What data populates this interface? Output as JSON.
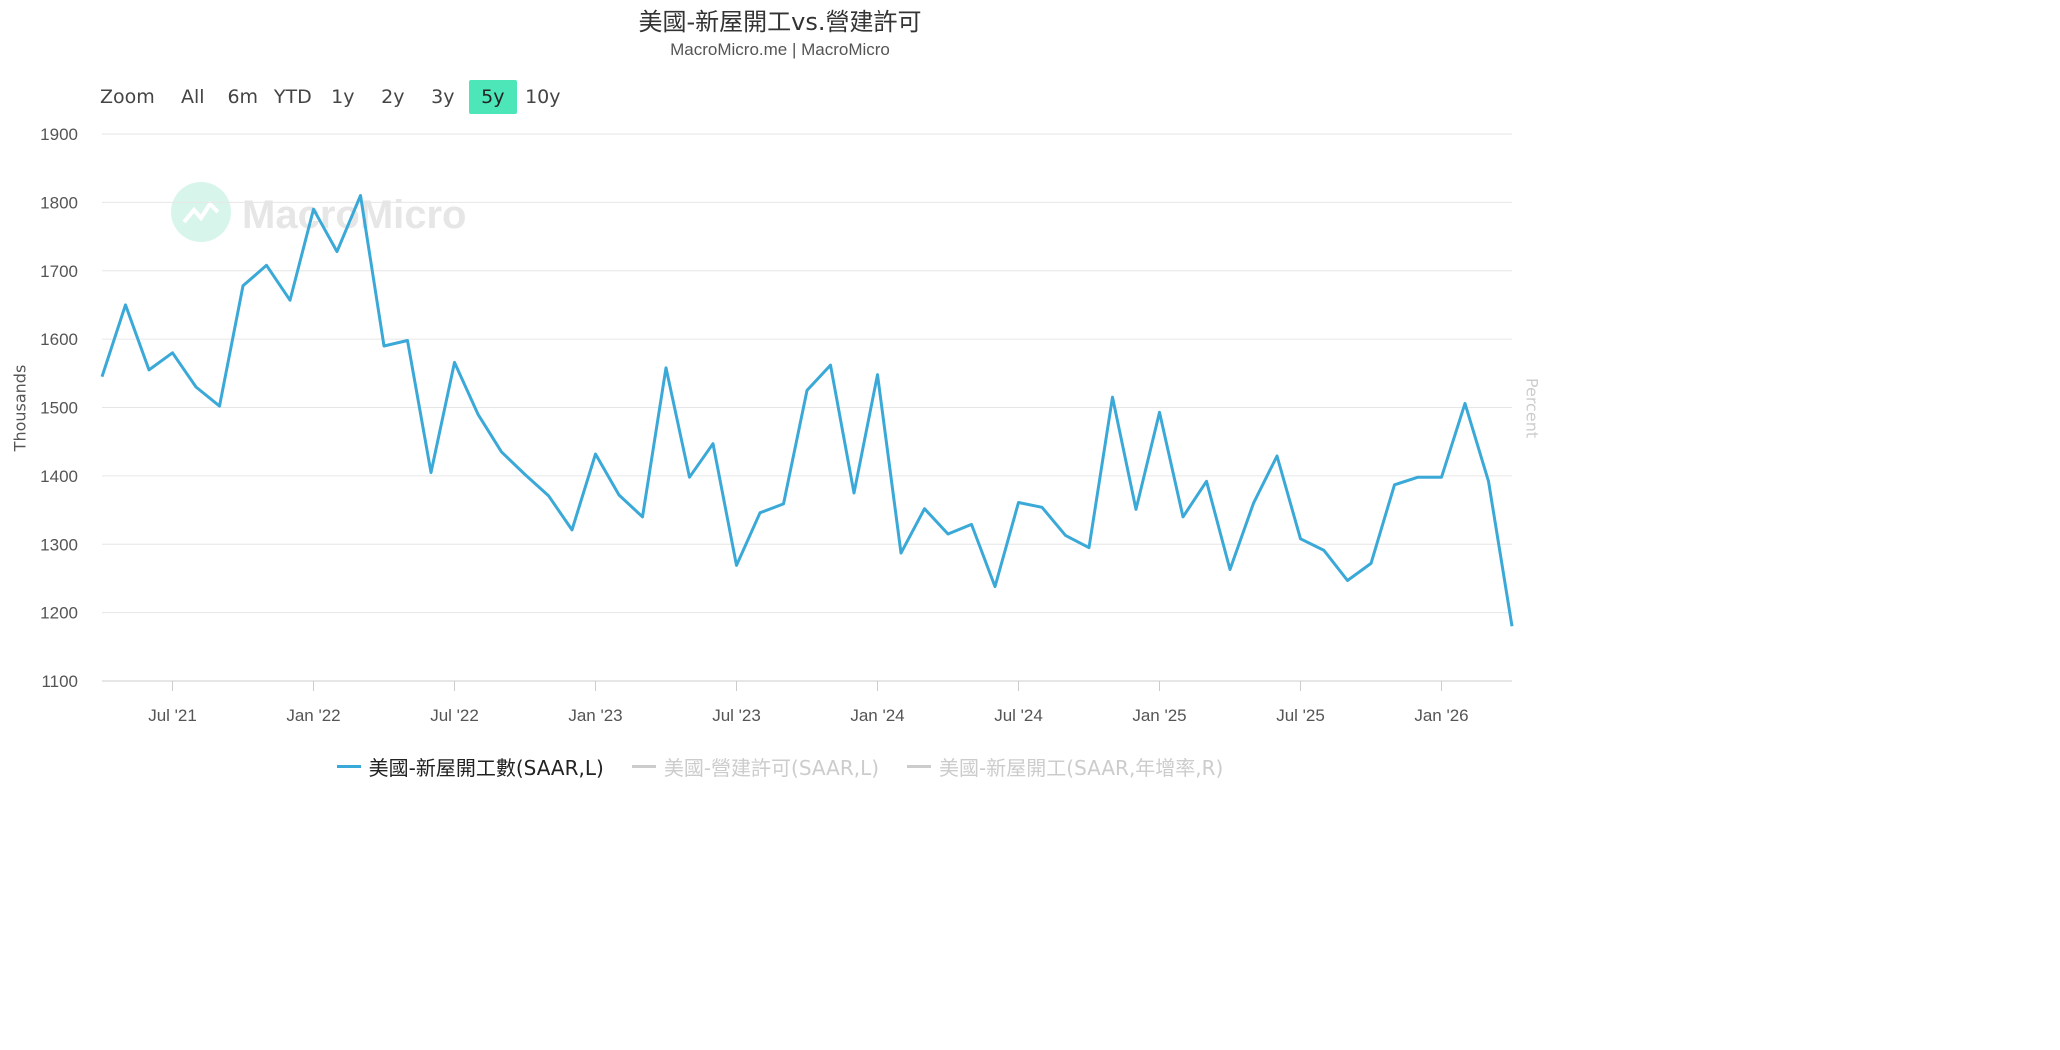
{
  "chart_data": {
    "type": "line",
    "title": "美國-新屋開工vs.營建許可",
    "subtitle": "MacroMicro.me | MacroMicro",
    "watermark": "MacroMicro",
    "ylabel": "Thousands",
    "ylabel_right": "Percent",
    "ylim": [
      1100,
      1900
    ],
    "yticks": [
      1100,
      1200,
      1300,
      1400,
      1500,
      1600,
      1700,
      1800,
      1900
    ],
    "grid": true,
    "legend_position": "bottom",
    "x_tick_labels": [
      "Jul '21",
      "Jan '22",
      "Jul '22",
      "Jan '23",
      "Jul '23",
      "Jan '24",
      "Jul '24",
      "Jan '25",
      "Jul '25",
      "Jan '26"
    ],
    "x": [
      "2021-04",
      "2021-05",
      "2021-06",
      "2021-07",
      "2021-08",
      "2021-09",
      "2021-10",
      "2021-11",
      "2021-12",
      "2022-01",
      "2022-02",
      "2022-03",
      "2022-04",
      "2022-05",
      "2022-06",
      "2022-07",
      "2022-08",
      "2022-09",
      "2022-10",
      "2022-11",
      "2022-12",
      "2023-01",
      "2023-02",
      "2023-03",
      "2023-04",
      "2023-05",
      "2023-06",
      "2023-07",
      "2023-08",
      "2023-09",
      "2023-10",
      "2023-11",
      "2023-12",
      "2024-01",
      "2024-02",
      "2024-03",
      "2024-04",
      "2024-05",
      "2024-06",
      "2024-07",
      "2024-08",
      "2024-09",
      "2024-10",
      "2024-11",
      "2024-12",
      "2025-01",
      "2025-02",
      "2025-03",
      "2025-04",
      "2025-05",
      "2025-06",
      "2025-07",
      "2025-08",
      "2025-09",
      "2025-10",
      "2025-11",
      "2025-12",
      "2026-01",
      "2026-02",
      "2026-03",
      "2026-04"
    ],
    "series": [
      {
        "name": "美國-新屋開工數(SAAR,L)",
        "color": "#3ba9d8",
        "visible": true,
        "values": [
          1545,
          1650,
          1555,
          1580,
          1530,
          1502,
          1678,
          1708,
          1657,
          1790,
          1728,
          1810,
          1590,
          1598,
          1405,
          1566,
          1490,
          1435,
          1402,
          1371,
          1321,
          1432,
          1372,
          1340,
          1558,
          1398,
          1447,
          1269,
          1346,
          1359,
          1525,
          1562,
          1375,
          1548,
          1287,
          1352,
          1315,
          1329,
          1238,
          1361,
          1354,
          1313,
          1295,
          1515,
          1351,
          1493,
          1340,
          1392,
          1263,
          1360,
          1429,
          1308,
          1291,
          1247,
          1272,
          1387,
          1398,
          1398,
          1506,
          1392,
          1180
        ]
      },
      {
        "name": "美國-營建許可(SAAR,L)",
        "color": "#cccccc",
        "visible": false
      },
      {
        "name": "美國-新屋開工(SAAR,年增率,R)",
        "color": "#cccccc",
        "visible": false
      }
    ]
  },
  "range_selector": {
    "zoom_label": "Zoom",
    "buttons": [
      {
        "label": "All",
        "active": false
      },
      {
        "label": "6m",
        "active": false
      },
      {
        "label": "YTD",
        "active": false
      },
      {
        "label": "1y",
        "active": false
      },
      {
        "label": "2y",
        "active": false
      },
      {
        "label": "3y",
        "active": false
      },
      {
        "label": "5y",
        "active": true
      },
      {
        "label": "10y",
        "active": false
      }
    ]
  }
}
